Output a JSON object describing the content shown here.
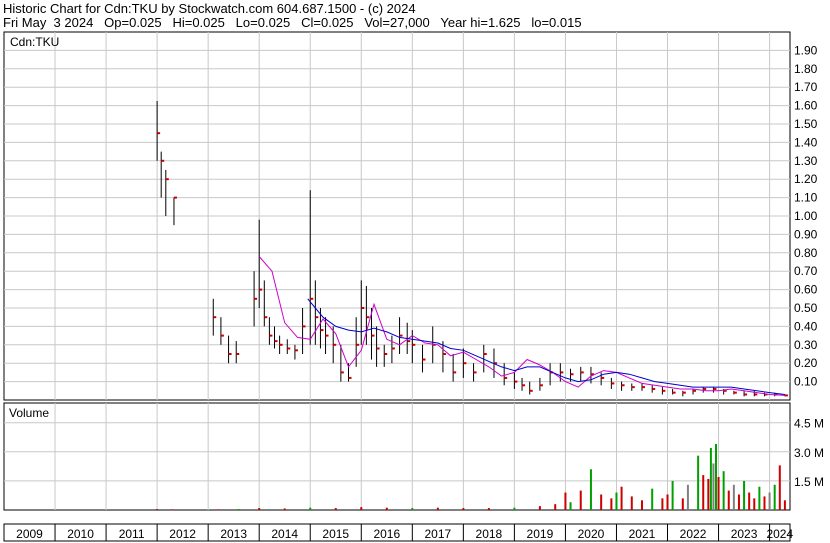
{
  "header": {
    "line1": "Historic Chart for Cdn:TKU by Stockwatch.com 604.687.1500 - (c) 2024",
    "line2": "Fri May  3 2024   Op=0.025   Hi=0.025   Lo=0.025   Cl=0.025   Vol=27,000   Year hi=1.625   lo=0.015"
  },
  "chart_data": [
    {
      "type": "line",
      "panel": "price",
      "symbol_label": "Cdn:TKU",
      "ylim": [
        0,
        2.0
      ],
      "yticks": [
        "1.90",
        "1.80",
        "1.70",
        "1.60",
        "1.50",
        "1.40",
        "1.30",
        "1.20",
        "1.10",
        "1.00",
        "0.90",
        "0.80",
        "0.70",
        "0.60",
        "0.50",
        "0.40",
        "0.30",
        "0.20",
        "0.10"
      ],
      "xlim": [
        2009.0,
        2024.4
      ],
      "x_tick_labels": [
        "2009",
        "2010",
        "2011",
        "2012",
        "2013",
        "2014",
        "2015",
        "2016",
        "2017",
        "2018",
        "2019",
        "2020",
        "2021",
        "2022",
        "2023",
        "2024"
      ],
      "grid": true,
      "colors": {
        "price_bar": "#000000",
        "close_tick": "#cc0000",
        "short_ma": "#cc00cc",
        "long_ma": "#0000cc",
        "grid": "#c8c8c8"
      },
      "x": [
        2012.0,
        2012.08,
        2012.17,
        2012.33,
        2013.1,
        2013.25,
        2013.4,
        2013.55,
        2013.9,
        2014.0,
        2014.1,
        2014.2,
        2014.3,
        2014.4,
        2014.55,
        2014.7,
        2014.85,
        2015.0,
        2015.1,
        2015.2,
        2015.3,
        2015.45,
        2015.6,
        2015.75,
        2015.9,
        2016.0,
        2016.1,
        2016.2,
        2016.3,
        2016.45,
        2016.6,
        2016.75,
        2016.9,
        2017.0,
        2017.2,
        2017.4,
        2017.6,
        2017.8,
        2018.0,
        2018.2,
        2018.4,
        2018.6,
        2018.8,
        2019.0,
        2019.15,
        2019.3,
        2019.5,
        2019.7,
        2019.9,
        2020.1,
        2020.3,
        2020.5,
        2020.7,
        2020.9,
        2021.1,
        2021.3,
        2021.5,
        2021.7,
        2021.9,
        2022.1,
        2022.3,
        2022.5,
        2022.7,
        2022.9,
        2023.1,
        2023.3,
        2023.5,
        2023.7,
        2023.9,
        2024.1,
        2024.3
      ],
      "high": [
        1.625,
        1.35,
        1.25,
        1.1,
        0.55,
        0.45,
        0.35,
        0.32,
        0.7,
        0.98,
        0.65,
        0.45,
        0.4,
        0.35,
        0.33,
        0.3,
        0.5,
        1.14,
        0.65,
        0.5,
        0.45,
        0.4,
        0.3,
        0.2,
        0.45,
        0.65,
        0.62,
        0.5,
        0.4,
        0.3,
        0.35,
        0.45,
        0.42,
        0.38,
        0.3,
        0.4,
        0.32,
        0.25,
        0.28,
        0.2,
        0.3,
        0.28,
        0.2,
        0.15,
        0.12,
        0.1,
        0.12,
        0.2,
        0.2,
        0.17,
        0.18,
        0.18,
        0.15,
        0.12,
        0.1,
        0.09,
        0.09,
        0.08,
        0.07,
        0.06,
        0.05,
        0.06,
        0.07,
        0.07,
        0.06,
        0.05,
        0.05,
        0.05,
        0.04,
        0.04,
        0.03
      ],
      "low": [
        1.3,
        1.1,
        1.0,
        0.95,
        0.35,
        0.3,
        0.2,
        0.2,
        0.4,
        0.5,
        0.4,
        0.3,
        0.28,
        0.25,
        0.25,
        0.22,
        0.25,
        0.3,
        0.3,
        0.28,
        0.25,
        0.2,
        0.1,
        0.1,
        0.18,
        0.3,
        0.3,
        0.22,
        0.18,
        0.18,
        0.2,
        0.25,
        0.25,
        0.2,
        0.15,
        0.2,
        0.15,
        0.1,
        0.12,
        0.1,
        0.15,
        0.12,
        0.08,
        0.06,
        0.05,
        0.03,
        0.05,
        0.08,
        0.1,
        0.1,
        0.1,
        0.09,
        0.08,
        0.06,
        0.05,
        0.05,
        0.05,
        0.04,
        0.03,
        0.03,
        0.02,
        0.03,
        0.04,
        0.04,
        0.03,
        0.03,
        0.02,
        0.02,
        0.02,
        0.02,
        0.02
      ],
      "close": [
        1.45,
        1.3,
        1.2,
        1.1,
        0.45,
        0.35,
        0.25,
        0.25,
        0.55,
        0.6,
        0.45,
        0.35,
        0.32,
        0.3,
        0.28,
        0.27,
        0.4,
        0.55,
        0.45,
        0.38,
        0.35,
        0.3,
        0.15,
        0.12,
        0.3,
        0.5,
        0.45,
        0.35,
        0.28,
        0.25,
        0.28,
        0.35,
        0.32,
        0.3,
        0.22,
        0.3,
        0.25,
        0.15,
        0.2,
        0.15,
        0.25,
        0.2,
        0.12,
        0.1,
        0.08,
        0.05,
        0.08,
        0.15,
        0.15,
        0.14,
        0.15,
        0.14,
        0.12,
        0.09,
        0.08,
        0.07,
        0.07,
        0.06,
        0.05,
        0.04,
        0.04,
        0.05,
        0.06,
        0.06,
        0.05,
        0.04,
        0.03,
        0.03,
        0.03,
        0.03,
        0.025
      ],
      "series": [
        {
          "name": "",
          "role": "short_ma",
          "x": [
            2014.0,
            2014.25,
            2014.5,
            2014.75,
            2015.0,
            2015.25,
            2015.5,
            2015.75,
            2016.0,
            2016.25,
            2016.5,
            2016.75,
            2017.0,
            2017.25,
            2017.5,
            2017.75,
            2018.0,
            2018.25,
            2018.5,
            2018.75,
            2019.0,
            2019.25,
            2019.5,
            2019.75,
            2020.0,
            2020.25,
            2020.5,
            2020.75,
            2021.0,
            2021.25,
            2021.5,
            2021.75,
            2022.0,
            2022.25,
            2022.5,
            2022.75,
            2023.0,
            2023.25,
            2023.5,
            2023.75,
            2024.0,
            2024.3
          ],
          "values": [
            0.78,
            0.7,
            0.42,
            0.34,
            0.33,
            0.44,
            0.36,
            0.18,
            0.27,
            0.52,
            0.33,
            0.3,
            0.35,
            0.31,
            0.3,
            0.24,
            0.26,
            0.22,
            0.18,
            0.13,
            0.15,
            0.22,
            0.19,
            0.15,
            0.1,
            0.07,
            0.13,
            0.16,
            0.15,
            0.12,
            0.09,
            0.08,
            0.07,
            0.06,
            0.06,
            0.05,
            0.05,
            0.06,
            0.05,
            0.04,
            0.03,
            0.025
          ]
        },
        {
          "name": "",
          "role": "long_ma",
          "x": [
            2014.95,
            2015.25,
            2015.5,
            2015.75,
            2016.0,
            2016.25,
            2016.5,
            2016.75,
            2017.0,
            2017.25,
            2017.5,
            2017.75,
            2018.0,
            2018.25,
            2018.5,
            2018.75,
            2019.0,
            2019.25,
            2019.5,
            2019.75,
            2020.0,
            2020.25,
            2020.5,
            2020.75,
            2021.0,
            2021.25,
            2021.5,
            2021.75,
            2022.0,
            2022.25,
            2022.5,
            2022.75,
            2023.0,
            2023.25,
            2023.5,
            2023.75,
            2024.0,
            2024.3
          ],
          "values": [
            0.55,
            0.45,
            0.4,
            0.38,
            0.37,
            0.39,
            0.37,
            0.34,
            0.33,
            0.32,
            0.31,
            0.28,
            0.27,
            0.24,
            0.21,
            0.18,
            0.16,
            0.18,
            0.18,
            0.15,
            0.12,
            0.1,
            0.11,
            0.14,
            0.15,
            0.14,
            0.12,
            0.1,
            0.09,
            0.08,
            0.07,
            0.07,
            0.07,
            0.07,
            0.06,
            0.05,
            0.04,
            0.03
          ]
        }
      ]
    },
    {
      "type": "bar",
      "panel": "volume",
      "title": "Volume",
      "ylim": [
        0,
        5.0
      ],
      "yticks": [
        "4.5 M",
        "3.0 M",
        "1.5 M"
      ],
      "ytick_values": [
        4.5,
        3.0,
        1.5
      ],
      "unit": "M",
      "x": [
        2012.0,
        2012.3,
        2013.2,
        2013.6,
        2014.0,
        2014.5,
        2015.0,
        2015.5,
        2016.0,
        2016.5,
        2017.0,
        2017.5,
        2018.0,
        2018.5,
        2019.0,
        2019.5,
        2019.8,
        2020.0,
        2020.1,
        2020.3,
        2020.5,
        2020.7,
        2020.9,
        2021.0,
        2021.1,
        2021.3,
        2021.5,
        2021.7,
        2021.9,
        2022.0,
        2022.1,
        2022.3,
        2022.4,
        2022.6,
        2022.7,
        2022.8,
        2022.85,
        2022.9,
        2022.95,
        2023.0,
        2023.1,
        2023.2,
        2023.3,
        2023.4,
        2023.5,
        2023.6,
        2023.7,
        2023.8,
        2023.9,
        2024.0,
        2024.1,
        2024.2,
        2024.3
      ],
      "values": [
        0.05,
        0.04,
        0.04,
        0.05,
        0.1,
        0.08,
        0.12,
        0.1,
        0.15,
        0.12,
        0.1,
        0.12,
        0.1,
        0.1,
        0.12,
        0.2,
        0.3,
        0.9,
        0.4,
        1.0,
        2.1,
        0.8,
        0.6,
        0.9,
        1.2,
        0.7,
        0.5,
        1.1,
        0.6,
        0.8,
        1.5,
        0.6,
        1.3,
        2.8,
        1.8,
        1.6,
        3.2,
        2.4,
        3.4,
        1.7,
        2.0,
        1.0,
        1.3,
        0.8,
        1.5,
        0.9,
        0.6,
        1.2,
        0.7,
        0.9,
        1.3,
        2.3,
        0.5
      ],
      "colors": [
        "#cc0000",
        "#00a000",
        "#808080"
      ],
      "color_cycle": [
        0,
        0,
        0,
        1,
        0,
        0,
        1,
        0,
        0,
        0,
        1,
        0,
        0,
        0,
        1,
        0,
        0,
        0,
        1,
        0,
        1,
        0,
        0,
        1,
        0,
        0,
        0,
        1,
        0,
        0,
        1,
        0,
        2,
        1,
        0,
        0,
        1,
        2,
        1,
        0,
        1,
        0,
        2,
        0,
        1,
        0,
        0,
        1,
        0,
        2,
        1,
        0,
        0
      ]
    }
  ]
}
